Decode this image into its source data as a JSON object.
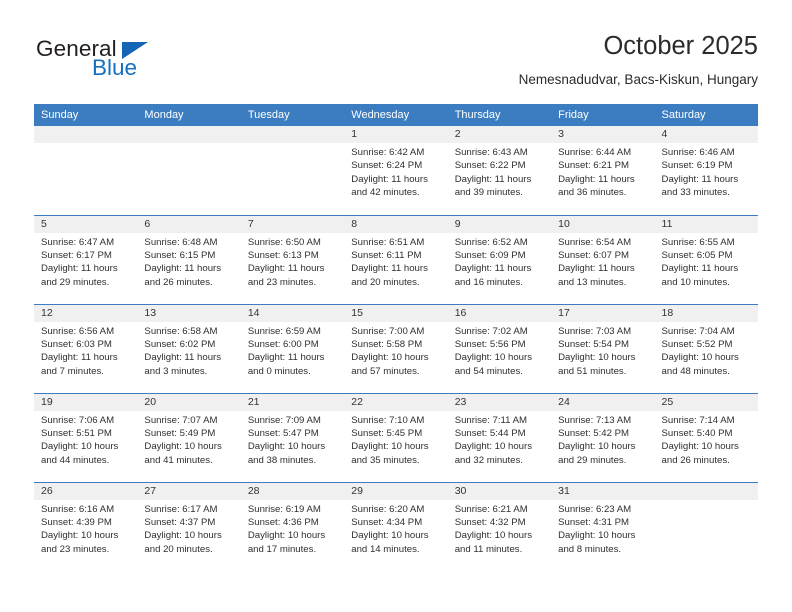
{
  "brand": {
    "name_part1": "General",
    "name_part2": "Blue",
    "accent_color": "#1570c0",
    "triangle_color": "#1565b4"
  },
  "header": {
    "title": "October 2025",
    "subtitle": "Nemesnadudvar, Bacs-Kiskun, Hungary"
  },
  "calendar": {
    "header_bg": "#3b7dc0",
    "daynum_bg": "#f0f0f0",
    "weekday_headers": [
      "Sunday",
      "Monday",
      "Tuesday",
      "Wednesday",
      "Thursday",
      "Friday",
      "Saturday"
    ],
    "weeks": [
      [
        {
          "day": "",
          "empty": true
        },
        {
          "day": "",
          "empty": true
        },
        {
          "day": "",
          "empty": true
        },
        {
          "day": "1",
          "sunrise": "Sunrise: 6:42 AM",
          "sunset": "Sunset: 6:24 PM",
          "daylight_line1": "Daylight: 11 hours",
          "daylight_line2": "and 42 minutes."
        },
        {
          "day": "2",
          "sunrise": "Sunrise: 6:43 AM",
          "sunset": "Sunset: 6:22 PM",
          "daylight_line1": "Daylight: 11 hours",
          "daylight_line2": "and 39 minutes."
        },
        {
          "day": "3",
          "sunrise": "Sunrise: 6:44 AM",
          "sunset": "Sunset: 6:21 PM",
          "daylight_line1": "Daylight: 11 hours",
          "daylight_line2": "and 36 minutes."
        },
        {
          "day": "4",
          "sunrise": "Sunrise: 6:46 AM",
          "sunset": "Sunset: 6:19 PM",
          "daylight_line1": "Daylight: 11 hours",
          "daylight_line2": "and 33 minutes."
        }
      ],
      [
        {
          "day": "5",
          "sunrise": "Sunrise: 6:47 AM",
          "sunset": "Sunset: 6:17 PM",
          "daylight_line1": "Daylight: 11 hours",
          "daylight_line2": "and 29 minutes."
        },
        {
          "day": "6",
          "sunrise": "Sunrise: 6:48 AM",
          "sunset": "Sunset: 6:15 PM",
          "daylight_line1": "Daylight: 11 hours",
          "daylight_line2": "and 26 minutes."
        },
        {
          "day": "7",
          "sunrise": "Sunrise: 6:50 AM",
          "sunset": "Sunset: 6:13 PM",
          "daylight_line1": "Daylight: 11 hours",
          "daylight_line2": "and 23 minutes."
        },
        {
          "day": "8",
          "sunrise": "Sunrise: 6:51 AM",
          "sunset": "Sunset: 6:11 PM",
          "daylight_line1": "Daylight: 11 hours",
          "daylight_line2": "and 20 minutes."
        },
        {
          "day": "9",
          "sunrise": "Sunrise: 6:52 AM",
          "sunset": "Sunset: 6:09 PM",
          "daylight_line1": "Daylight: 11 hours",
          "daylight_line2": "and 16 minutes."
        },
        {
          "day": "10",
          "sunrise": "Sunrise: 6:54 AM",
          "sunset": "Sunset: 6:07 PM",
          "daylight_line1": "Daylight: 11 hours",
          "daylight_line2": "and 13 minutes."
        },
        {
          "day": "11",
          "sunrise": "Sunrise: 6:55 AM",
          "sunset": "Sunset: 6:05 PM",
          "daylight_line1": "Daylight: 11 hours",
          "daylight_line2": "and 10 minutes."
        }
      ],
      [
        {
          "day": "12",
          "sunrise": "Sunrise: 6:56 AM",
          "sunset": "Sunset: 6:03 PM",
          "daylight_line1": "Daylight: 11 hours",
          "daylight_line2": "and 7 minutes."
        },
        {
          "day": "13",
          "sunrise": "Sunrise: 6:58 AM",
          "sunset": "Sunset: 6:02 PM",
          "daylight_line1": "Daylight: 11 hours",
          "daylight_line2": "and 3 minutes."
        },
        {
          "day": "14",
          "sunrise": "Sunrise: 6:59 AM",
          "sunset": "Sunset: 6:00 PM",
          "daylight_line1": "Daylight: 11 hours",
          "daylight_line2": "and 0 minutes."
        },
        {
          "day": "15",
          "sunrise": "Sunrise: 7:00 AM",
          "sunset": "Sunset: 5:58 PM",
          "daylight_line1": "Daylight: 10 hours",
          "daylight_line2": "and 57 minutes."
        },
        {
          "day": "16",
          "sunrise": "Sunrise: 7:02 AM",
          "sunset": "Sunset: 5:56 PM",
          "daylight_line1": "Daylight: 10 hours",
          "daylight_line2": "and 54 minutes."
        },
        {
          "day": "17",
          "sunrise": "Sunrise: 7:03 AM",
          "sunset": "Sunset: 5:54 PM",
          "daylight_line1": "Daylight: 10 hours",
          "daylight_line2": "and 51 minutes."
        },
        {
          "day": "18",
          "sunrise": "Sunrise: 7:04 AM",
          "sunset": "Sunset: 5:52 PM",
          "daylight_line1": "Daylight: 10 hours",
          "daylight_line2": "and 48 minutes."
        }
      ],
      [
        {
          "day": "19",
          "sunrise": "Sunrise: 7:06 AM",
          "sunset": "Sunset: 5:51 PM",
          "daylight_line1": "Daylight: 10 hours",
          "daylight_line2": "and 44 minutes."
        },
        {
          "day": "20",
          "sunrise": "Sunrise: 7:07 AM",
          "sunset": "Sunset: 5:49 PM",
          "daylight_line1": "Daylight: 10 hours",
          "daylight_line2": "and 41 minutes."
        },
        {
          "day": "21",
          "sunrise": "Sunrise: 7:09 AM",
          "sunset": "Sunset: 5:47 PM",
          "daylight_line1": "Daylight: 10 hours",
          "daylight_line2": "and 38 minutes."
        },
        {
          "day": "22",
          "sunrise": "Sunrise: 7:10 AM",
          "sunset": "Sunset: 5:45 PM",
          "daylight_line1": "Daylight: 10 hours",
          "daylight_line2": "and 35 minutes."
        },
        {
          "day": "23",
          "sunrise": "Sunrise: 7:11 AM",
          "sunset": "Sunset: 5:44 PM",
          "daylight_line1": "Daylight: 10 hours",
          "daylight_line2": "and 32 minutes."
        },
        {
          "day": "24",
          "sunrise": "Sunrise: 7:13 AM",
          "sunset": "Sunset: 5:42 PM",
          "daylight_line1": "Daylight: 10 hours",
          "daylight_line2": "and 29 minutes."
        },
        {
          "day": "25",
          "sunrise": "Sunrise: 7:14 AM",
          "sunset": "Sunset: 5:40 PM",
          "daylight_line1": "Daylight: 10 hours",
          "daylight_line2": "and 26 minutes."
        }
      ],
      [
        {
          "day": "26",
          "sunrise": "Sunrise: 6:16 AM",
          "sunset": "Sunset: 4:39 PM",
          "daylight_line1": "Daylight: 10 hours",
          "daylight_line2": "and 23 minutes."
        },
        {
          "day": "27",
          "sunrise": "Sunrise: 6:17 AM",
          "sunset": "Sunset: 4:37 PM",
          "daylight_line1": "Daylight: 10 hours",
          "daylight_line2": "and 20 minutes."
        },
        {
          "day": "28",
          "sunrise": "Sunrise: 6:19 AM",
          "sunset": "Sunset: 4:36 PM",
          "daylight_line1": "Daylight: 10 hours",
          "daylight_line2": "and 17 minutes."
        },
        {
          "day": "29",
          "sunrise": "Sunrise: 6:20 AM",
          "sunset": "Sunset: 4:34 PM",
          "daylight_line1": "Daylight: 10 hours",
          "daylight_line2": "and 14 minutes."
        },
        {
          "day": "30",
          "sunrise": "Sunrise: 6:21 AM",
          "sunset": "Sunset: 4:32 PM",
          "daylight_line1": "Daylight: 10 hours",
          "daylight_line2": "and 11 minutes."
        },
        {
          "day": "31",
          "sunrise": "Sunrise: 6:23 AM",
          "sunset": "Sunset: 4:31 PM",
          "daylight_line1": "Daylight: 10 hours",
          "daylight_line2": "and 8 minutes."
        },
        {
          "day": "",
          "empty": true
        }
      ]
    ]
  }
}
